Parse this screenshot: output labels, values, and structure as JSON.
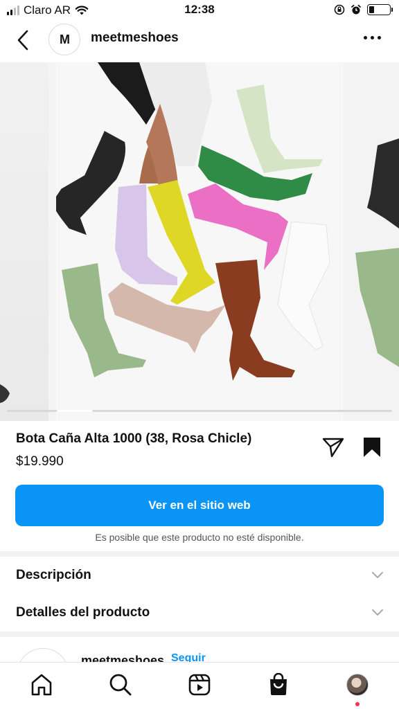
{
  "status_bar": {
    "carrier": "Claro AR",
    "time": "12:38",
    "battery_level": 0.25
  },
  "header": {
    "logo_text": "M",
    "account_name": "meetmeshoes",
    "back_icon": "chevron-left-icon",
    "more_icon": "more-horizontal-icon"
  },
  "carousel": {
    "image_subject": "product-photo-boots",
    "position": 1
  },
  "product": {
    "title": "Bota Caña Alta 1000 (38, Rosa Chicle)",
    "price": "$19.990",
    "cta_label": "Ver en el sitio web",
    "availability_note": "Es posible que este producto no esté disponible."
  },
  "sections": [
    {
      "label": "Descripción"
    },
    {
      "label": "Detalles del producto"
    }
  ],
  "seller": {
    "name": "meetmeshoes",
    "follow_label": "Seguir"
  },
  "bottom_nav": {
    "items": [
      "home-icon",
      "search-icon",
      "reels-icon",
      "shop-icon",
      "profile-avatar"
    ]
  },
  "colors": {
    "accent": "#0a95f6",
    "notification": "#ff2d55"
  }
}
